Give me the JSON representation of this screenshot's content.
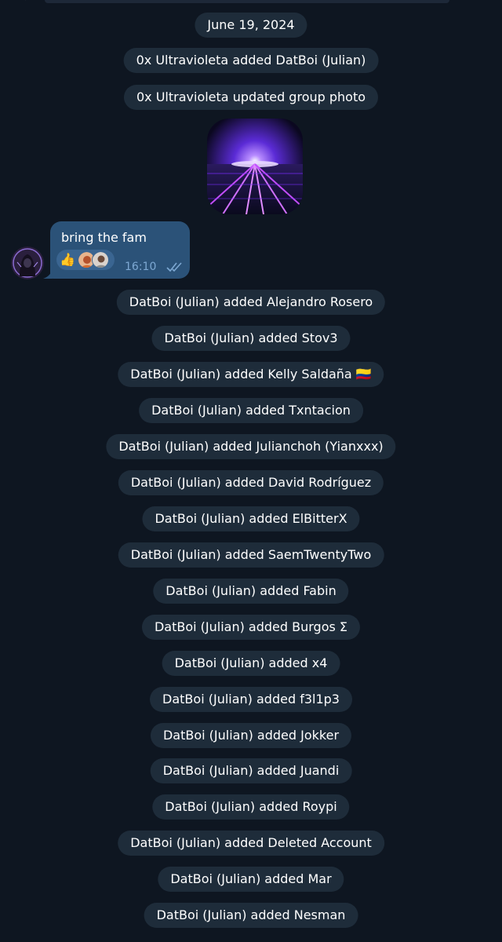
{
  "date_separator": "June 19, 2024",
  "service_messages_top": [
    "0x Ultravioleta added DatBoi (Julian)",
    "0x Ultravioleta updated group photo"
  ],
  "group_photo": {
    "icon": "synthwave-horizon-image",
    "colors": [
      "#7a2cff",
      "#c24dff",
      "#0b0820"
    ]
  },
  "message": {
    "text": "bring the fam",
    "time": "16:10",
    "status_icon": "double-check-icon",
    "reaction_emoji": "👍",
    "sender_avatar_icon": "hooded-figure-avatar"
  },
  "service_messages_added": [
    "DatBoi (Julian) added Alejandro Rosero",
    "DatBoi (Julian) added Stov3",
    "DatBoi (Julian) added Kelly Saldaña 🇨🇴",
    "DatBoi (Julian) added Txntacion",
    "DatBoi (Julian) added Julianchoh (Yianxxx)",
    "DatBoi (Julian) added David Rodríguez",
    "DatBoi (Julian) added ElBitterX",
    "DatBoi (Julian) added SaemTwentyTwo",
    "DatBoi (Julian) added Fabin",
    "DatBoi (Julian) added Burgos Σ",
    "DatBoi (Julian) added x4",
    "DatBoi (Julian) added f3l1p3",
    "DatBoi (Julian) added Jokker",
    "DatBoi (Julian) added Juandi",
    "DatBoi (Julian) added Roypi",
    "DatBoi (Julian) added Deleted Account",
    "DatBoi (Julian) added Mar",
    "DatBoi (Julian) added Nesman"
  ],
  "colors": {
    "background": "#0e1621",
    "pill": "#1e2c3a",
    "bubble": "#2b5278",
    "time_text": "#7da8d3"
  }
}
